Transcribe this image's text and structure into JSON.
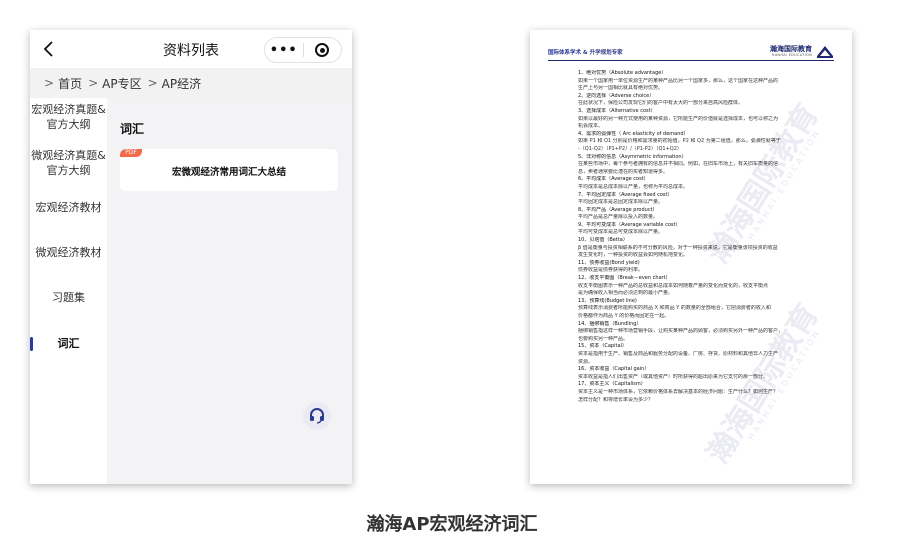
{
  "phone": {
    "nav_title": "资料列表",
    "capsule_dots": "•••",
    "breadcrumb": [
      "首页",
      "AP专区",
      "AP经济"
    ],
    "sidebar": [
      {
        "label": "宏观经济真题&官方大纲"
      },
      {
        "label": "微观经济真题&官方大纲"
      },
      {
        "label": "宏观经济教材"
      },
      {
        "label": "微观经济教材"
      },
      {
        "label": "习题集"
      },
      {
        "label": "词汇",
        "active": true
      }
    ],
    "section_title": "词汇",
    "card": {
      "tag": "PDF",
      "title": "宏微观经济常用词汇大总结"
    },
    "icons": {
      "back": "chevron-left-icon",
      "more": "more-dots-icon",
      "close": "target-close-icon",
      "support": "headset-icon"
    },
    "colors": {
      "active": "#2d3a8c",
      "tag": "#f26a4a",
      "content_bg": "#f3f3f5"
    }
  },
  "doc": {
    "header_tag": "国际体系学术 & 升学规划专家",
    "brand": "瀚海国际教育",
    "brand_sub": "HANHAI EDUCATION",
    "watermark": "瀚海国际教育",
    "watermark_en": "HANHAI EDUCATION",
    "lines": [
      {
        "t": "1、绝对优势（Absolute advantage）",
        "h": true
      },
      {
        "t": "如果一个国家用一单位资源生产的某种产品比另一个国家多，那么，这个国家在这种产品的"
      },
      {
        "t": "生产上与另一国相比就具有绝对优势。"
      },
      {
        "t": "2、逆向选择（Adverse choice）",
        "h": true
      },
      {
        "t": "在此状况下，保险公司发现它们的客户中有太大的一部分来自高风险群体。"
      },
      {
        "t": "3、选择成本（Alternative cost）",
        "h": true
      },
      {
        "t": "如果以最好的另一种方式使用的某种资源，它所能生产的价值就是选择成本，也可以称之为"
      },
      {
        "t": "机会成本。"
      },
      {
        "t": "4、需求的弧弹性（ Arc elasticity of demand）",
        "h": true
      },
      {
        "t": "如果 P1 和 Q1 分别是价格和需求量的初始值，P2 和 Q2 为第二组值，那么，弧弹性就等于"
      },
      {
        "t": "-（Q1-Q2）（P1+P2）/（P1-P2）（Q1+Q2）"
      },
      {
        "t": "5、非对称的信息（Asymmetric information）",
        "h": true
      },
      {
        "t": "在某些市场中，每个参与者拥有的信息并不相同。例如，在旧车市场上，有关旧车质量的信"
      },
      {
        "t": "息，卖者通常要比潜在的买者知道得多。"
      },
      {
        "t": "6、平均成本（Average cost）",
        "h": true
      },
      {
        "t": "平均成本是总成本除以产量，也称为平均总成本。"
      },
      {
        "t": "7、平均固定成本（Average fixed cost）",
        "h": true
      },
      {
        "t": "平均固定成本是总固定成本除以产量。"
      },
      {
        "t": "8、平均产品（Average product）",
        "h": true
      },
      {
        "t": "平均产品是总产量除以投入的数量。"
      },
      {
        "t": "9、平均可变成本（Average variable cost）",
        "h": true
      },
      {
        "t": "平均可变成本是总可变成本除以产量。"
      },
      {
        "t": "10、贝塔值（Betta）",
        "h": true
      },
      {
        "t": "β 值是衡量与投资相联系的不可分散的风险。对于一种投资来说，它是衡量该项投资的收益"
      },
      {
        "t": "发生变化时，一种投资的收益会如何随机地变化。"
      },
      {
        "t": "11、债券收益(Bond yield)",
        "h": true
      },
      {
        "t": "债券收益是债券获得的利率。"
      },
      {
        "t": "12、收支平衡图（Break－even chart）",
        "h": true
      },
      {
        "t": "收支平衡图表示一种产品的总收益和总成本如何随着产量的变化而变化的，收支平衡点"
      },
      {
        "t": "是为确保收入相当而必须达到的最小产量。"
      },
      {
        "t": "13、预算线(Budget line)",
        "h": true
      },
      {
        "t": "预算线表示消费者所能购买的商品 X 和商品 Y 的数量的全部组合，它把消费者的收入和"
      },
      {
        "t": "价格都作为商品 Y 的价格而固定在一起。"
      },
      {
        "t": "14、捆绑销售（Bundling）",
        "h": true
      },
      {
        "t": "捆绑销售指这样一种市场营销手段，让购买某种产品的顾客，必须购买另外一种产品的客户，"
      },
      {
        "t": "也要购买另一种产品。"
      },
      {
        "t": "15、资本（Capital）",
        "h": true
      },
      {
        "t": "资本是指用于生产、销售及商品和服务分配的设备、厂房、存货、原材料和其他非人力生产"
      },
      {
        "t": "资源。"
      },
      {
        "t": "16、资本收益（Capital gain）",
        "h": true
      },
      {
        "t": "资本收益是指人们出售资产（或其他资产）时所获得的超出原来为它支付的那一部分。"
      },
      {
        "t": "17、资本主义（Capitalism）",
        "h": true
      },
      {
        "t": "资本主义是一种市场体系，它依赖价格体系去解决基本的经济问题：生产什么？如何生产？"
      },
      {
        "t": "怎样分配？和将增长率设为多少？"
      }
    ]
  },
  "caption": "瀚海AP宏观经济词汇"
}
